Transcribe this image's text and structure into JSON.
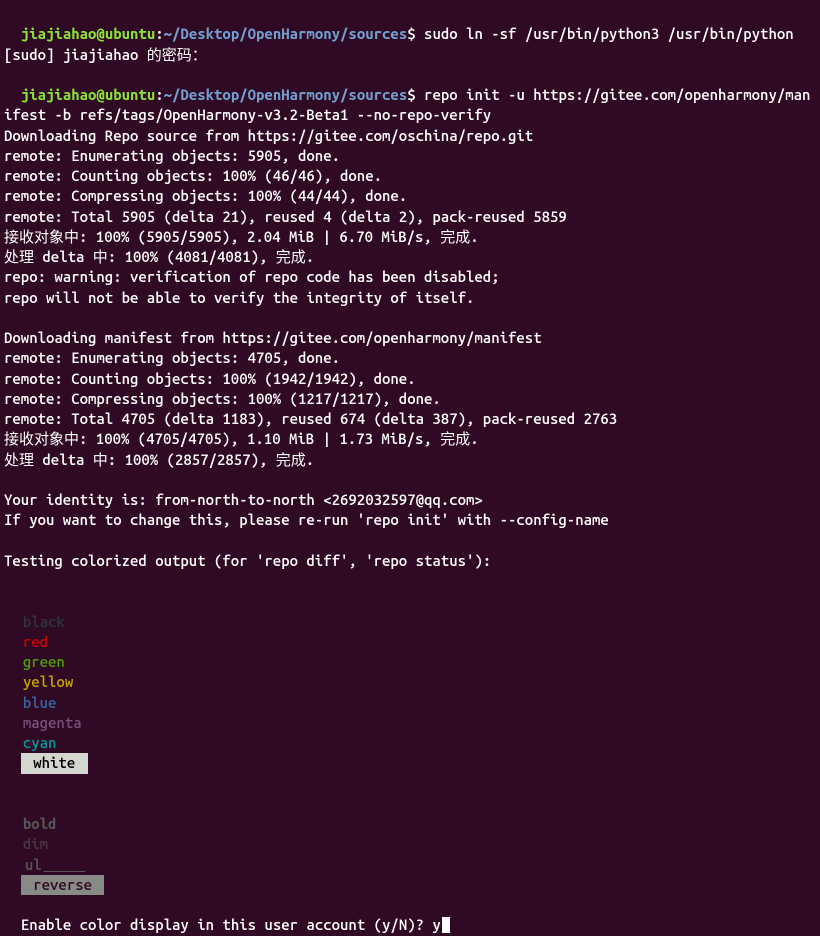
{
  "prompt": {
    "user_host": "jiajiahao@ubuntu",
    "sep": ":",
    "path": "~/Desktop/OpenHarmony/sources",
    "sym": "$"
  },
  "cmd1": "sudo ln -sf /usr/bin/python3 /usr/bin/python",
  "sudo_line": "[sudo] jiajiahao 的密码：",
  "cmd2": "repo init -u https://gitee.com/openharmony/manifest -b refs/tags/OpenHarmony-v3.2-Beta1 --no-repo-verify",
  "out1": [
    "Downloading Repo source from https://gitee.com/oschina/repo.git",
    "remote: Enumerating objects: 5905, done.",
    "remote: Counting objects: 100% (46/46), done.",
    "remote: Compressing objects: 100% (44/44), done.",
    "remote: Total 5905 (delta 21), reused 4 (delta 2), pack-reused 5859",
    "接收对象中: 100% (5905/5905), 2.04 MiB | 6.70 MiB/s, 完成.",
    "处理 delta 中: 100% (4081/4081), 完成.",
    "repo: warning: verification of repo code has been disabled;",
    "repo will not be able to verify the integrity of itself.",
    "",
    "Downloading manifest from https://gitee.com/openharmony/manifest",
    "remote: Enumerating objects: 4705, done.",
    "remote: Counting objects: 100% (1942/1942), done.",
    "remote: Compressing objects: 100% (1217/1217), done.",
    "remote: Total 4705 (delta 1183), reused 674 (delta 387), pack-reused 2763",
    "接收对象中: 100% (4705/4705), 1.10 MiB | 1.73 MiB/s, 完成.",
    "处理 delta 中: 100% (2857/2857), 完成.",
    "",
    "Your identity is: from-north-to-north <2692032597@qq.com>",
    "If you want to change this, please re-run 'repo init' with --config-name",
    "",
    "Testing colorized output (for 'repo diff', 'repo status'):"
  ],
  "colors_row1": {
    "black": "black",
    "red": "red",
    "green": "green",
    "yellow": "yellow",
    "blue": "blue",
    "magenta": "magenta",
    "cyan": "cyan",
    "white": "white"
  },
  "colors_row2": {
    "bold": "bold",
    "dim": "dim",
    "ul": "ul",
    "reverse": "reverse"
  },
  "final_prompt": "Enable color display in this user account (y/N)? ",
  "final_input": "y"
}
